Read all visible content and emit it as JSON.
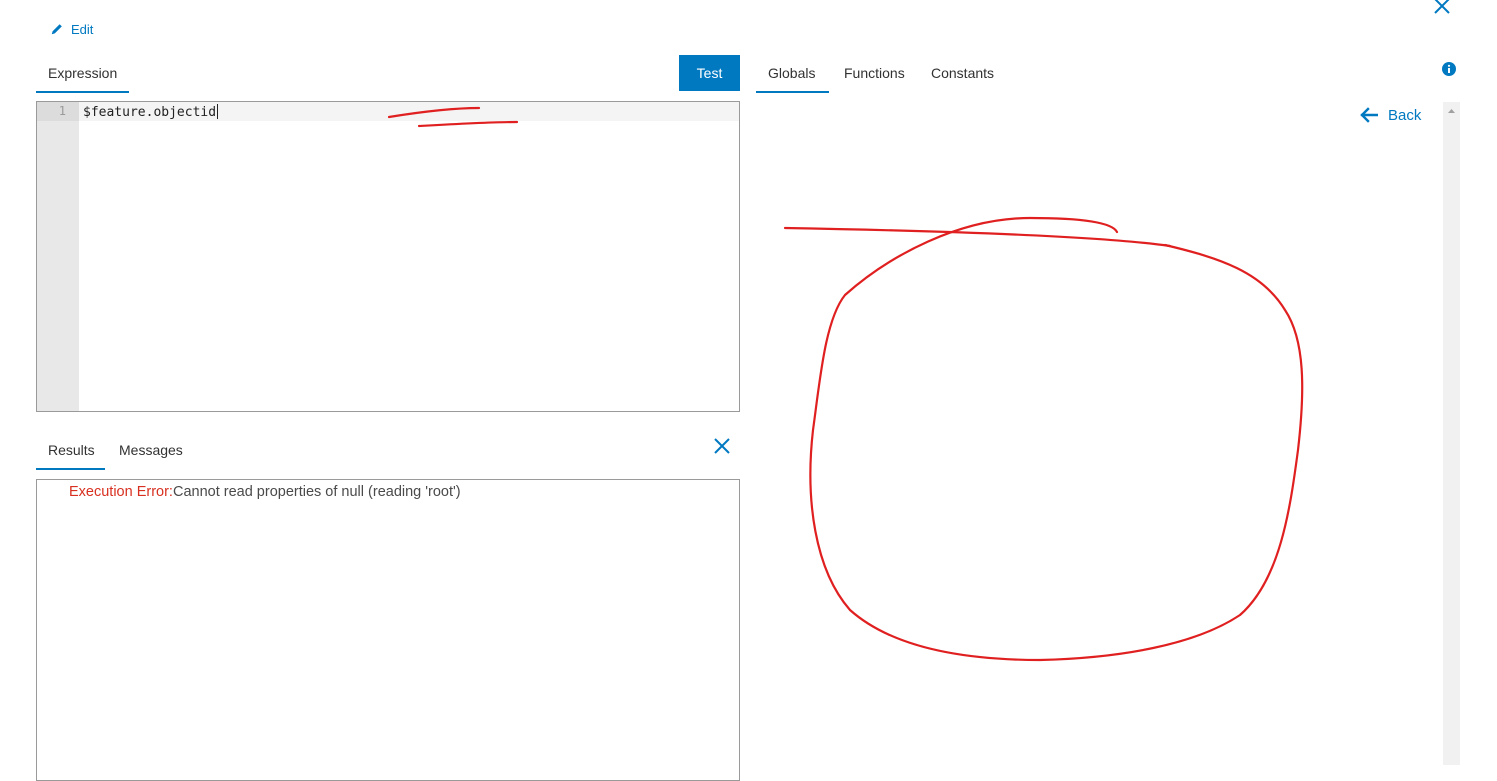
{
  "header": {
    "edit_label": "Edit"
  },
  "editor": {
    "tab_label": "Expression",
    "test_label": "Test",
    "line_number": "1",
    "code": "$feature.objectid"
  },
  "sidebar": {
    "tabs": [
      {
        "label": "Globals",
        "active": true
      },
      {
        "label": "Functions",
        "active": false
      },
      {
        "label": "Constants",
        "active": false
      }
    ],
    "back_label": "Back"
  },
  "results": {
    "tabs": [
      {
        "label": "Results",
        "active": true
      },
      {
        "label": "Messages",
        "active": false
      }
    ],
    "error_label": "Execution Error:",
    "error_message": "Cannot read properties of null (reading 'root')"
  },
  "icons": {
    "edit": "pencil-icon",
    "close_top": "close-icon",
    "info": "info-icon",
    "close_results": "close-icon",
    "back": "arrow-left-icon",
    "scroll_up": "chevron-up-icon"
  },
  "colors": {
    "accent": "#0079c1",
    "error": "#d83020",
    "annotation": "#e02020"
  }
}
